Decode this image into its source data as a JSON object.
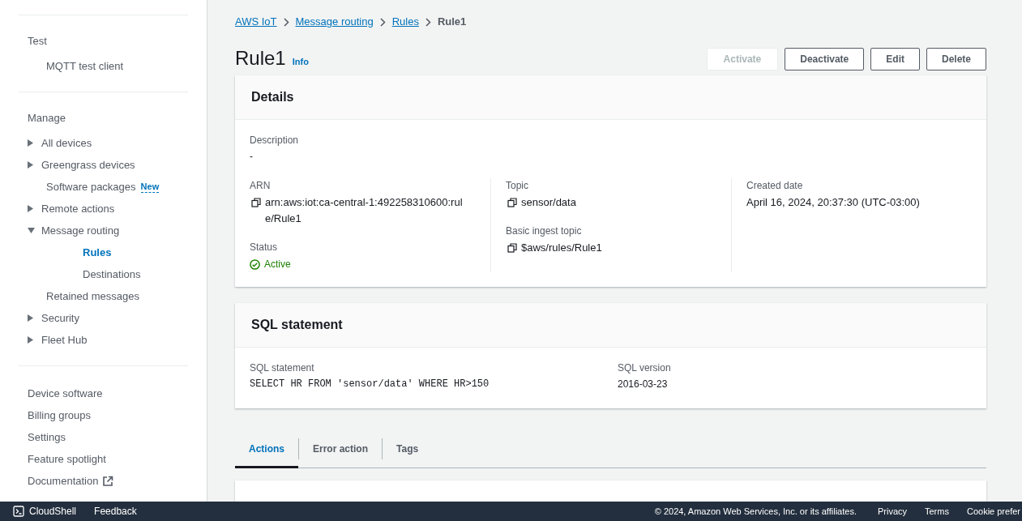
{
  "sidebar": {
    "sections": [
      {
        "title": "Test",
        "items": [
          {
            "kind": "link",
            "label": "MQTT test client",
            "selected": false
          }
        ]
      },
      {
        "title": "Manage",
        "items": [
          {
            "kind": "group",
            "label": "All devices",
            "expanded": false,
            "selected": false
          },
          {
            "kind": "group",
            "label": "Greengrass devices",
            "expanded": false,
            "selected": false
          },
          {
            "kind": "link",
            "label": "Software packages",
            "badge": "New",
            "selected": false
          },
          {
            "kind": "group",
            "label": "Remote actions",
            "expanded": false,
            "selected": false
          },
          {
            "kind": "group",
            "label": "Message routing",
            "expanded": true,
            "selected": false,
            "children": [
              {
                "kind": "link",
                "label": "Rules",
                "selected": true
              },
              {
                "kind": "link",
                "label": "Destinations",
                "selected": false
              }
            ]
          },
          {
            "kind": "link",
            "label": "Retained messages",
            "selected": false
          },
          {
            "kind": "group",
            "label": "Security",
            "expanded": false,
            "selected": false
          },
          {
            "kind": "group",
            "label": "Fleet Hub",
            "expanded": false,
            "selected": false
          }
        ]
      },
      {
        "items": [
          {
            "kind": "top",
            "label": "Device software",
            "selected": false
          },
          {
            "kind": "top",
            "label": "Billing groups",
            "selected": false
          },
          {
            "kind": "top",
            "label": "Settings",
            "selected": false
          },
          {
            "kind": "top",
            "label": "Feature spotlight",
            "selected": false
          },
          {
            "kind": "top",
            "label": "Documentation",
            "external": true,
            "selected": false
          }
        ]
      }
    ]
  },
  "breadcrumbs": [
    {
      "label": "AWS IoT",
      "link": true
    },
    {
      "label": "Message routing",
      "link": true
    },
    {
      "label": "Rules",
      "link": true
    },
    {
      "label": "Rule1",
      "link": false
    }
  ],
  "page_title": "Rule1",
  "info_link": "Info",
  "buttons": [
    {
      "label": "Activate",
      "disabled": true
    },
    {
      "label": "Deactivate",
      "disabled": false
    },
    {
      "label": "Edit",
      "disabled": false
    },
    {
      "label": "Delete",
      "disabled": false
    }
  ],
  "details": {
    "title": "Details",
    "description_label": "Description",
    "description": "-",
    "columns": [
      [
        {
          "label": "ARN",
          "value": "arn:aws:iot:ca-central-1:492258310600:rule/Rule1",
          "copy": true
        },
        {
          "label": "Status",
          "value": "Active",
          "kind": "status"
        }
      ],
      [
        {
          "label": "Topic",
          "value": "sensor/data",
          "copy": true
        },
        {
          "label": "Basic ingest topic",
          "value": "$aws/rules/Rule1",
          "copy": true
        }
      ],
      [
        {
          "label": "Created date",
          "value": "April 16, 2024, 20:37:30 (UTC-03:00)",
          "copy": false
        }
      ]
    ]
  },
  "sql": {
    "title": "SQL statement",
    "fields": [
      {
        "label": "SQL statement",
        "value": "SELECT HR FROM 'sensor/data' WHERE HR>150",
        "kind": "code"
      },
      {
        "label": "SQL version",
        "value": "2016-03-23",
        "kind": "text"
      }
    ]
  },
  "tabs": [
    {
      "label": "Actions",
      "selected": true
    },
    {
      "label": "Error action",
      "selected": false
    },
    {
      "label": "Tags",
      "selected": false
    }
  ],
  "footer": {
    "left": [
      {
        "label": "CloudShell",
        "kind": "cloudshell"
      },
      {
        "label": "Feedback",
        "kind": "link"
      }
    ],
    "copyright": "© 2024, Amazon Web Services, Inc. or its affiliates.",
    "links": [
      "Privacy",
      "Terms",
      "Cookie prefer"
    ]
  }
}
